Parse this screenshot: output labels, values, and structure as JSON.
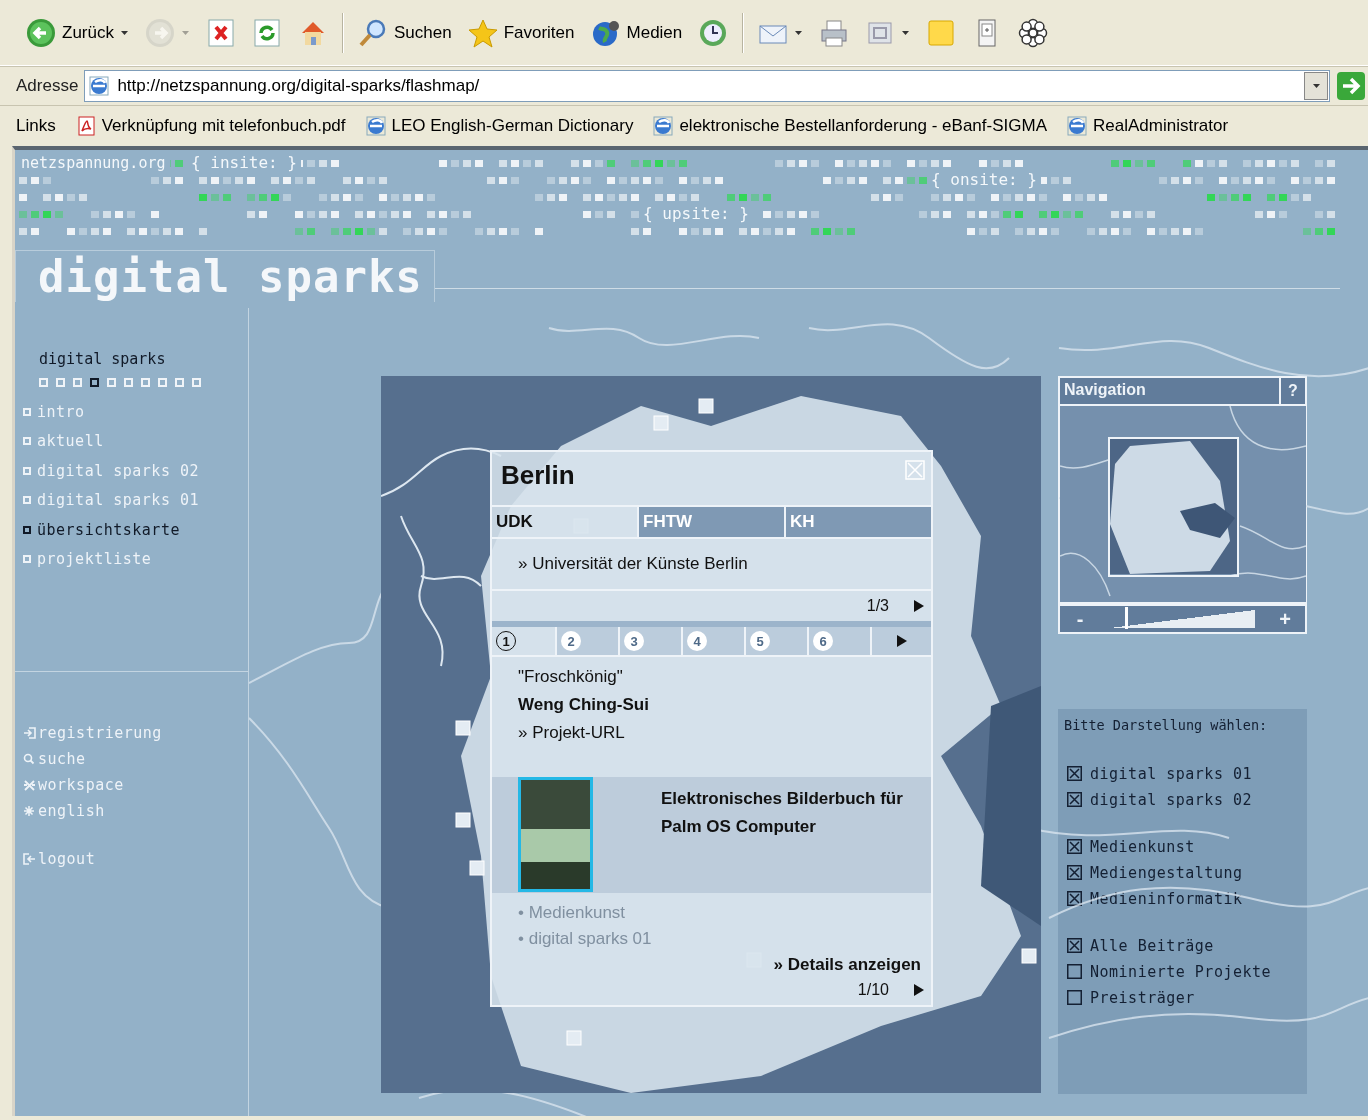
{
  "browser": {
    "toolbar": {
      "groups": [
        [
          {
            "kind": "back",
            "label": "Zurück",
            "dropdown": true,
            "disabled": false
          },
          {
            "kind": "forward",
            "dropdown": true,
            "disabled": true
          },
          {
            "kind": "stop",
            "dropdown": false,
            "disabled": false
          },
          {
            "kind": "refresh",
            "dropdown": false,
            "disabled": false
          },
          {
            "kind": "home",
            "dropdown": false,
            "disabled": false
          }
        ],
        [
          {
            "kind": "search",
            "label": "Suchen",
            "dropdown": false,
            "disabled": false
          },
          {
            "kind": "favorites",
            "label": "Favoriten",
            "dropdown": false,
            "disabled": false
          },
          {
            "kind": "media",
            "label": "Medien",
            "dropdown": false,
            "disabled": false
          },
          {
            "kind": "history",
            "dropdown": false,
            "disabled": false
          }
        ],
        [
          {
            "kind": "mail",
            "dropdown": true,
            "disabled": false
          },
          {
            "kind": "print",
            "dropdown": false,
            "disabled": false
          },
          {
            "kind": "edit",
            "dropdown": true,
            "disabled": false
          },
          {
            "kind": "notes",
            "dropdown": false,
            "disabled": false
          },
          {
            "kind": "device",
            "dropdown": false,
            "disabled": false
          },
          {
            "kind": "flower",
            "dropdown": false,
            "disabled": false
          }
        ]
      ]
    },
    "address": {
      "label": "Adresse",
      "url": "http://netzspannung.org/digital-sparks/flashmap/"
    },
    "links": {
      "label": "Links",
      "items": [
        {
          "kind": "pdf",
          "label": "Verknüpfung mit telefonbuch.pdf"
        },
        {
          "kind": "page",
          "label": "LEO English-German Dictionary"
        },
        {
          "kind": "page",
          "label": "elektronische Bestellanforderung - eBanf-SIGMA"
        },
        {
          "kind": "page",
          "label": "RealAdministrator"
        }
      ]
    }
  },
  "header": {
    "site": "netzspannung.org",
    "areas": [
      {
        "label": "{ insite: }"
      },
      {
        "label": "{ onsite: }"
      },
      {
        "label": "{ upsite: }"
      }
    ],
    "title": "digital sparks"
  },
  "sidebar": {
    "heading": "digital sparks",
    "pages": [
      {
        "selected": false
      },
      {
        "selected": false
      },
      {
        "selected": false
      },
      {
        "selected": true
      },
      {
        "selected": false
      },
      {
        "selected": false
      },
      {
        "selected": false
      },
      {
        "selected": false
      },
      {
        "selected": false
      },
      {
        "selected": false
      }
    ],
    "items": [
      {
        "label": "intro",
        "selected": false
      },
      {
        "label": "aktuell",
        "selected": false
      },
      {
        "label": "digital sparks 02",
        "selected": false
      },
      {
        "label": "digital sparks 01",
        "selected": false
      },
      {
        "label": "übersichtskarte",
        "selected": true
      },
      {
        "label": "projektliste",
        "selected": false
      }
    ],
    "links": [
      {
        "kind": "register",
        "label": "registrierung"
      },
      {
        "kind": "search",
        "label": "suche"
      },
      {
        "kind": "workspace",
        "label": "workspace"
      },
      {
        "kind": "language",
        "label": "english"
      }
    ],
    "logout": {
      "label": "logout"
    }
  },
  "popup": {
    "city": "Berlin",
    "tabs": [
      {
        "label": "UDK",
        "selected": true
      },
      {
        "label": "FHTW",
        "selected": false
      },
      {
        "label": "KH",
        "selected": false
      }
    ],
    "institution": "» Universität der Künste Berlin",
    "institution_pager": "1/3",
    "project_tabs": [
      {
        "label": "1",
        "selected": true
      },
      {
        "label": "2",
        "selected": false
      },
      {
        "label": "3",
        "selected": false
      },
      {
        "label": "4",
        "selected": false
      },
      {
        "label": "5",
        "selected": false
      },
      {
        "label": "6",
        "selected": false
      }
    ],
    "project": {
      "title": "\"Froschkönig\"",
      "author": "Weng Ching-Sui",
      "url": "» Projekt-URL",
      "description": "Elektronisches Bilderbuch für Palm OS Computer",
      "categories": [
        "• Medienkunst",
        "• digital sparks 01"
      ],
      "details": "» Details anzeigen",
      "pager": "1/10"
    }
  },
  "navigation": {
    "title": "Navigation",
    "help": "?",
    "zoom": {
      "minus": "-",
      "plus": "+",
      "level": 0.1
    }
  },
  "filters": {
    "heading": "Bitte Darstellung wählen:",
    "groups": [
      [
        {
          "label": "digital sparks 01",
          "checked": true
        },
        {
          "label": "digital sparks 02",
          "checked": true
        }
      ],
      [
        {
          "label": "Medienkunst",
          "checked": true
        },
        {
          "label": "Mediengestaltung",
          "checked": true
        },
        {
          "label": "Medieninformatik",
          "checked": true
        }
      ],
      [
        {
          "label": "Alle Beiträge",
          "checked": true
        },
        {
          "label": "Nominierte Projekte",
          "checked": false
        },
        {
          "label": "Preisträger",
          "checked": false
        }
      ]
    ]
  }
}
